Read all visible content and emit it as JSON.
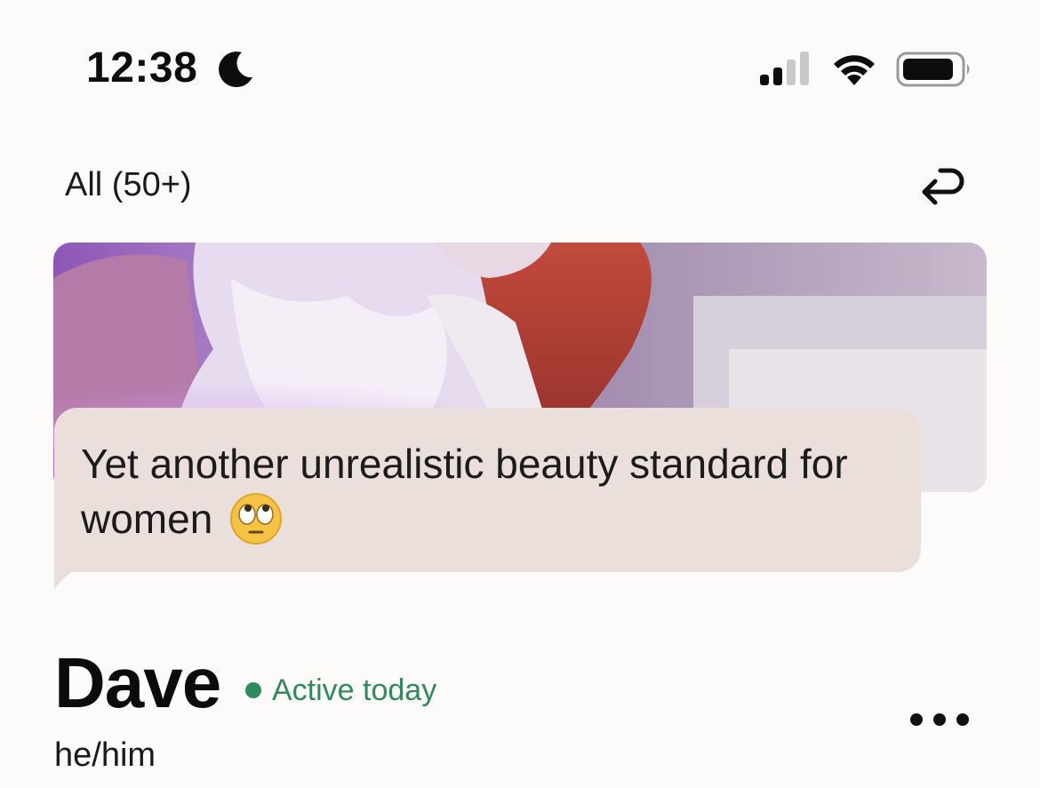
{
  "status_bar": {
    "time": "12:38",
    "focus_icon": "moon-icon",
    "signal_icon": "cellular-signal-icon",
    "wifi_icon": "wifi-icon",
    "battery_icon": "battery-icon"
  },
  "header": {
    "filter_label": "All (50+)",
    "undo_icon": "undo-arrow-icon"
  },
  "photo": {
    "icon": "profile-photo",
    "accent_colors": [
      "#8a5ab0",
      "#d45a3a",
      "#f2eef0"
    ]
  },
  "comment": {
    "text": "Yet another unrealistic beauty standard for women",
    "emoji_icon": "face-with-rolling-eyes-emoji",
    "bubble_color": "#ebdfdb"
  },
  "profile": {
    "name": "Dave",
    "status": "Active today",
    "status_color": "#2f8a5c",
    "pronouns": "he/him",
    "more_icon": "more-dots-icon"
  }
}
